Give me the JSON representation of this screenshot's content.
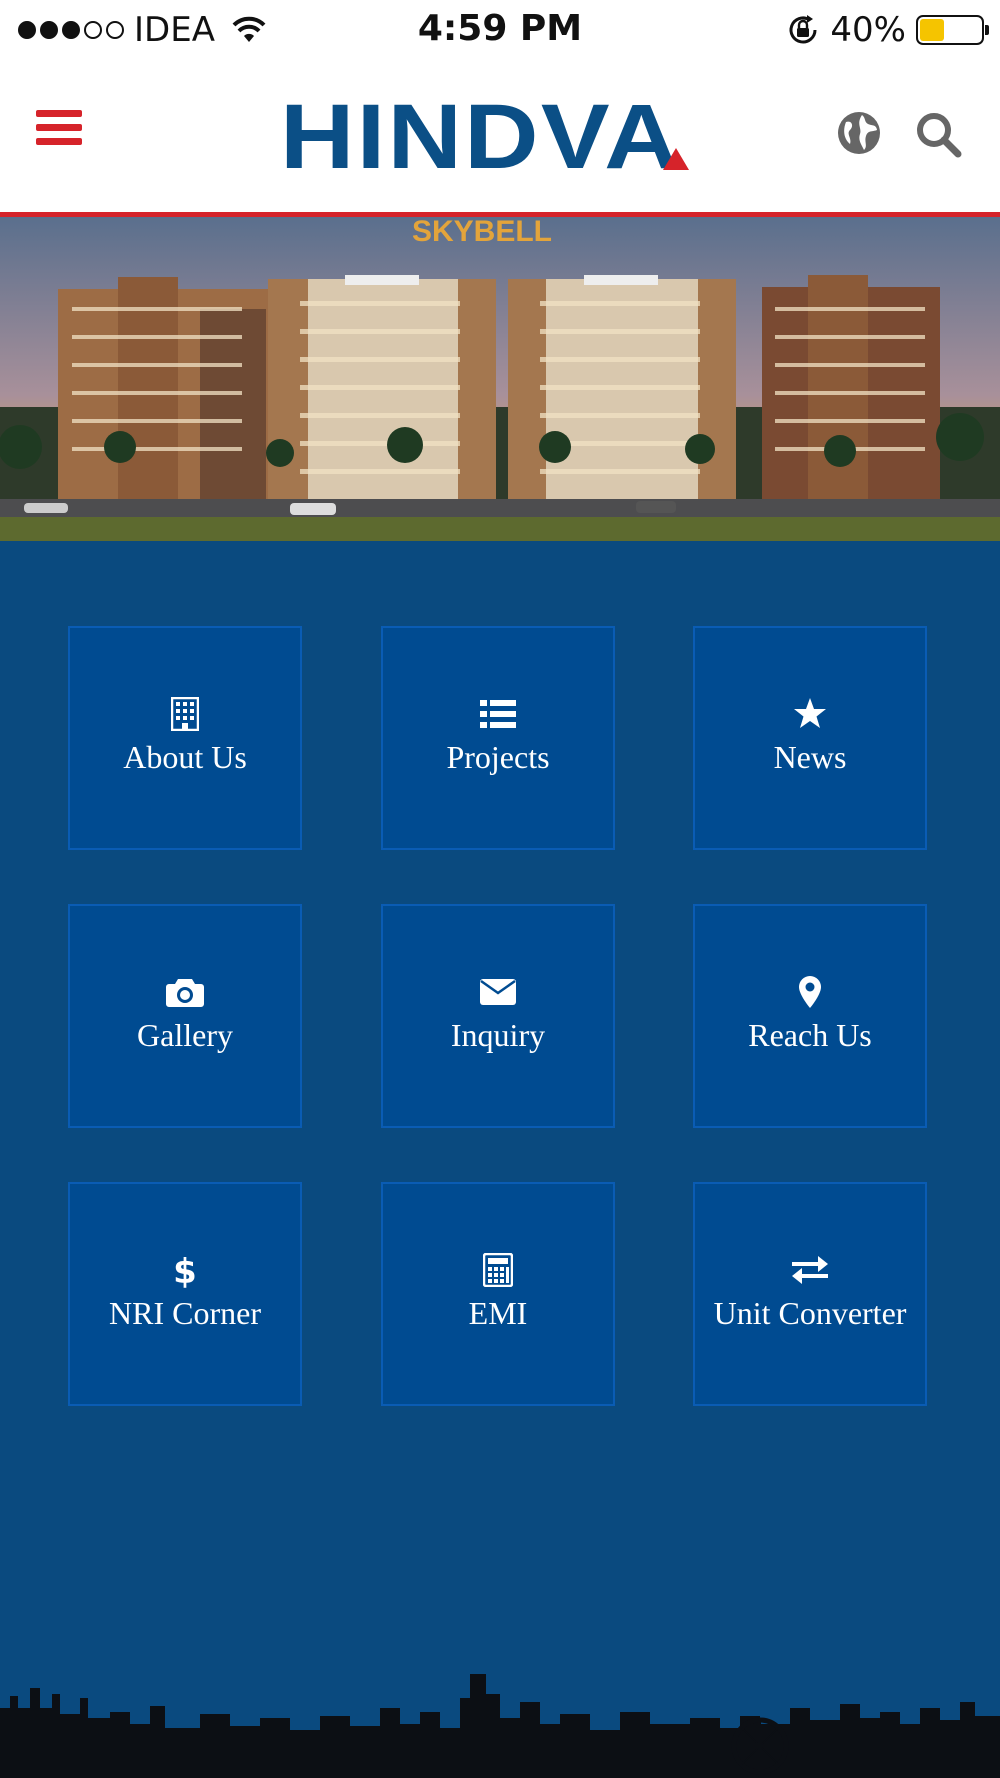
{
  "status_bar": {
    "carrier": "IDEA",
    "time": "4:59 PM",
    "battery_percent": "40%",
    "battery_level": 0.4,
    "signal_bars_filled": 3,
    "signal_bars_total": 5,
    "icons": [
      "wifi-icon",
      "rotation-lock-icon",
      "battery-icon"
    ]
  },
  "header": {
    "logo_text": "HINDVA",
    "accent_color": "#d6232a",
    "brand_color": "#0b4f86",
    "icons": [
      "hamburger-menu-icon",
      "globe-icon",
      "search-icon"
    ]
  },
  "hero": {
    "sign_text": "SKYBELL"
  },
  "tiles": [
    {
      "label": "About Us",
      "icon": "building-icon"
    },
    {
      "label": "Projects",
      "icon": "list-icon"
    },
    {
      "label": "News",
      "icon": "star-icon"
    },
    {
      "label": "Gallery",
      "icon": "camera-icon"
    },
    {
      "label": "Inquiry",
      "icon": "envelope-icon"
    },
    {
      "label": "Reach Us",
      "icon": "map-marker-icon"
    },
    {
      "label": "NRI Corner",
      "icon": "dollar-icon"
    },
    {
      "label": "EMI",
      "icon": "calculator-icon"
    },
    {
      "label": "Unit Converter",
      "icon": "exchange-icon"
    }
  ],
  "colors": {
    "background": "#0a4a7f",
    "tile": "#004b91",
    "tile_border": "#0a5cb4"
  }
}
